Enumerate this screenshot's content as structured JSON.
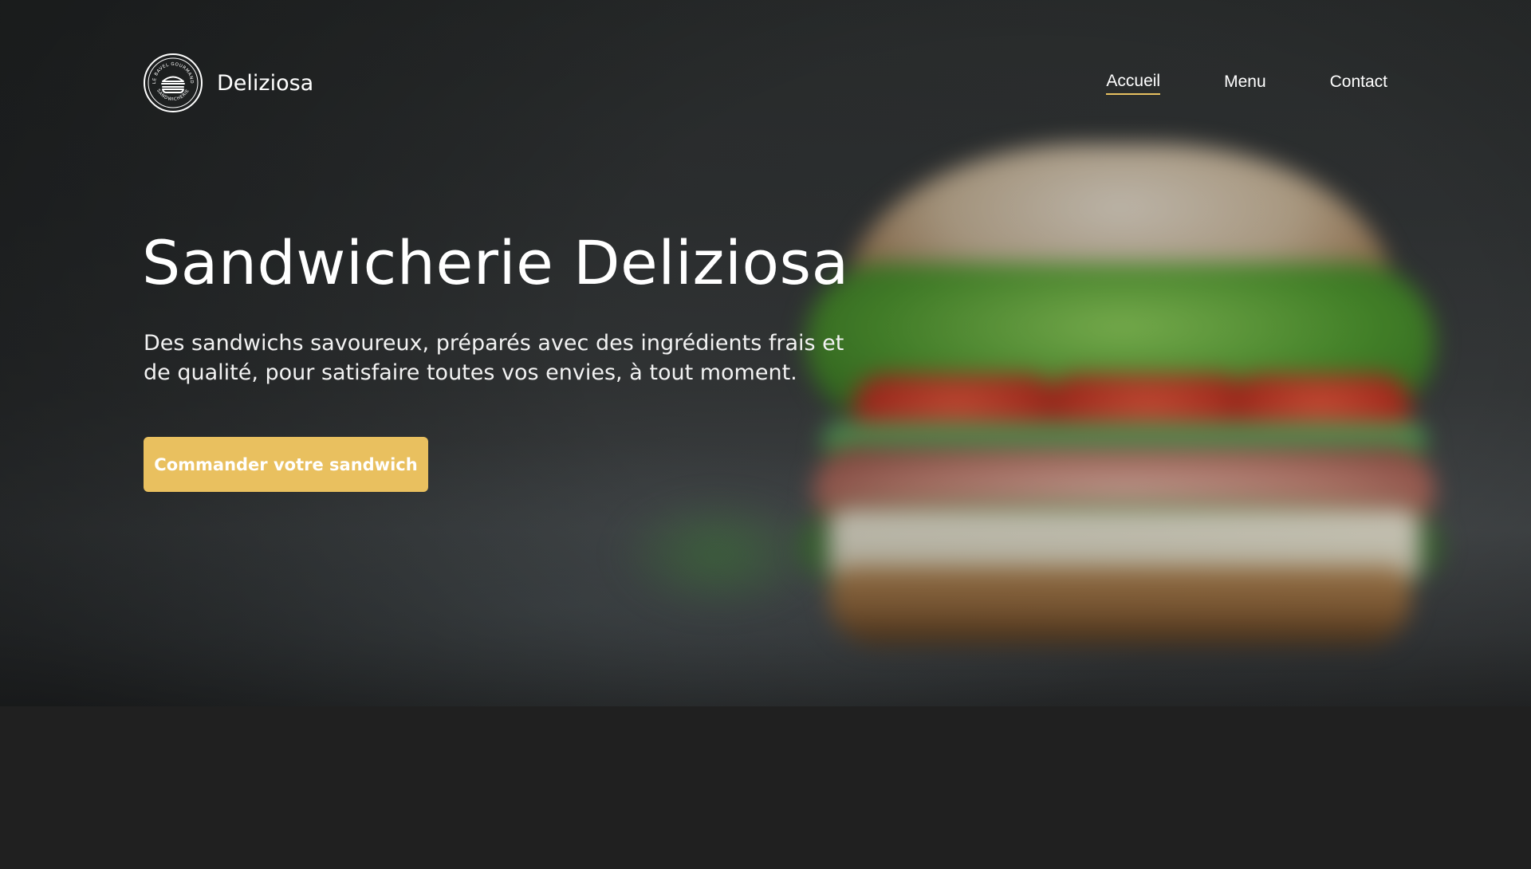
{
  "header": {
    "brand_name": "Deliziosa",
    "logo_arc_text_top": "LE BAVEL GOURMAND",
    "logo_arc_text_bottom": "SANDWICHERIE"
  },
  "nav": {
    "items": [
      {
        "label": "Accueil",
        "active": true
      },
      {
        "label": "Menu",
        "active": false
      },
      {
        "label": "Contact",
        "active": false
      }
    ]
  },
  "hero": {
    "title": "Sandwicherie Deliziosa",
    "subtitle": "Des sandwichs savoureux, préparés avec des ingrédients frais et de qualité, pour satisfaire toutes vos envies, à tout moment.",
    "cta_label": "Commander votre sandwich"
  },
  "colors": {
    "accent": "#e9c05f",
    "background": "#202020",
    "text": "#ffffff"
  },
  "icons": {
    "logo": "sandwich-badge-icon"
  }
}
